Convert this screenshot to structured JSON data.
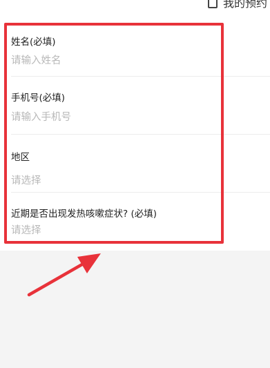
{
  "header": {
    "link_label": "我的预约",
    "link_icon": "document-icon"
  },
  "form": {
    "name": {
      "label": "姓名(必填)",
      "placeholder": "请输入姓名"
    },
    "phone": {
      "label": "手机号(必填)",
      "placeholder": "请输入手机号"
    },
    "region": {
      "label": "地区",
      "placeholder": "请选择"
    },
    "symptoms": {
      "label": "近期是否出现发热咳嗽症状? (必填)",
      "placeholder": "请选择"
    }
  },
  "annotation": {
    "box_color": "#e8323a",
    "arrow_color": "#e8323a"
  }
}
